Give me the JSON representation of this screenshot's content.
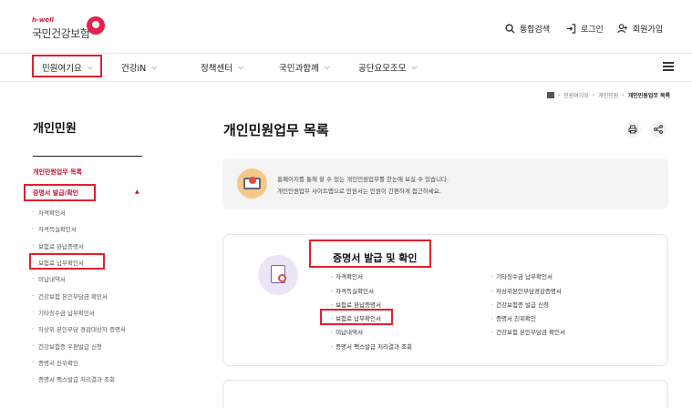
{
  "header": {
    "logo_top": "h-well",
    "logo_name": "국민건강보험",
    "util": [
      {
        "icon": "search-icon",
        "label": "통합검색"
      },
      {
        "icon": "login-icon",
        "label": "로그인"
      },
      {
        "icon": "user-plus-icon",
        "label": "회원가입"
      }
    ]
  },
  "gnb": {
    "items": [
      "민원여기요",
      "건강iN",
      "정책센터",
      "국민과함께",
      "공단요모조모"
    ]
  },
  "breadcrumb": {
    "items": [
      "민원여기요",
      "개인민원"
    ],
    "current": "개인민원업무 목록"
  },
  "lnb": {
    "title": "개인민원",
    "category": "개인민원업무 목록",
    "section": "증명서 발급/확인",
    "items": [
      "자격확인서",
      "자격득실확인서",
      "보험료 완납증명서",
      "보험료 납부확인서",
      "미납내역서",
      "건강보험 본인부담금 확인서",
      "기타징수금 납부확인서",
      "자상위 본인부담 경감대상자 증명서",
      "건강보험증 우편발급 신청",
      "증명서 진위확인",
      "증명서 팩스발급 처리결과 조회"
    ]
  },
  "main": {
    "title": "개인민원업무 목록",
    "tools": [
      {
        "icon": "print-icon"
      },
      {
        "icon": "share-icon"
      }
    ],
    "notice": [
      "홈페이지를 통해 할 수 있는 개인민원업무를 한눈에 보실 수 있습니다.",
      "개인민원업무 사이트맵으로 민원서는 민원이 간편하게 접근하세요."
    ],
    "card": {
      "title": "증명서 발급 및 확인",
      "left": [
        "자격확인서",
        "자격득실확인서",
        "보험료 완납증명서",
        "보험료 납부확인서",
        "미납내역서",
        "증명서 팩스발급 처리결과 조회"
      ],
      "right": [
        "기타징수금 납부확인서",
        "자상위본인부담경감증명서",
        "건강보험증 발급 신청",
        "증명서 진위확인",
        "건강보험 본인부담금 확인서"
      ]
    }
  },
  "colors": {
    "brand_red": "#d6203e",
    "highlight_box": "#e0202c"
  }
}
